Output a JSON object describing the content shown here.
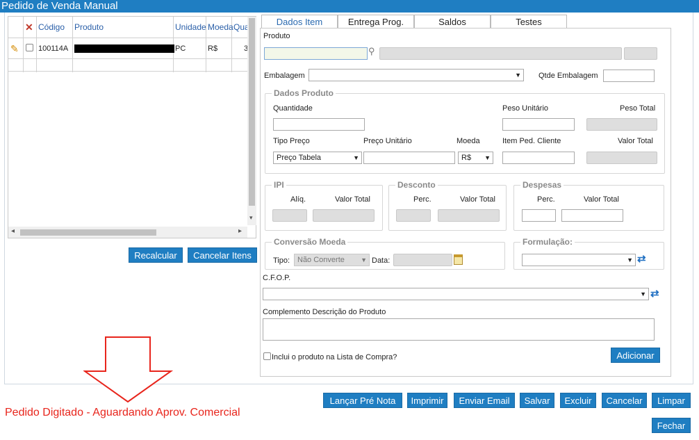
{
  "window": {
    "title": "Pedido de Venda Manual"
  },
  "grid": {
    "headers": [
      "Código",
      "Produto",
      "Unidade",
      "Moeda",
      "Qua"
    ],
    "row": {
      "codigo": "100114A",
      "unidade": "PC",
      "moeda": "R$",
      "qtd": "3"
    },
    "scroll_left": "◂",
    "scroll_right": "▸",
    "scroll_down": "▾"
  },
  "left_buttons": {
    "recalcular": "Recalcular",
    "cancelar_itens": "Cancelar Itens"
  },
  "tabs": [
    {
      "label": "Dados Item",
      "active": true
    },
    {
      "label": "Entrega Prog."
    },
    {
      "label": "Saldos"
    },
    {
      "label": "Testes"
    }
  ],
  "form": {
    "produto": "Produto",
    "embalagem": "Embalagem",
    "qtde_embalagem": "Qtde Embalagem",
    "dados_produto": "Dados Produto",
    "quantidade": "Quantidade",
    "peso_unitario": "Peso Unitário",
    "peso_total": "Peso Total",
    "tipo_preco": "Tipo Preço",
    "tipo_preco_value": "Preço Tabela",
    "preco_unitario": "Preço Unitário",
    "moeda": "Moeda",
    "moeda_value": "R$",
    "item_ped_cliente": "Item Ped. Cliente",
    "valor_total": "Valor Total",
    "ipi": "IPI",
    "aliq": "Alíq.",
    "desconto": "Desconto",
    "perc": "Perc.",
    "despesas": "Despesas",
    "conversao_moeda": "Conversão Moeda",
    "tipo": "Tipo:",
    "tipo_value": "Não Converte",
    "data": "Data:",
    "formulacao": "Formulação:",
    "cfop": "C.F.O.P.",
    "complemento": "Complemento Descrição do Produto",
    "inclui_lista": "Inclui o produto na Lista de Compra?",
    "adicionar": "Adicionar"
  },
  "status": {
    "message": "Pedido Digitado - Aguardando Aprov. Comercial"
  },
  "actions": [
    "Lançar Pré Nota",
    "Imprimir",
    "Enviar Email",
    "Salvar",
    "Excluir",
    "Cancelar",
    "Limpar"
  ],
  "fechar": "Fechar",
  "colors": {
    "accent": "#1f7ec2",
    "status": "#e8251c",
    "header_text": "#2a5fa8"
  }
}
